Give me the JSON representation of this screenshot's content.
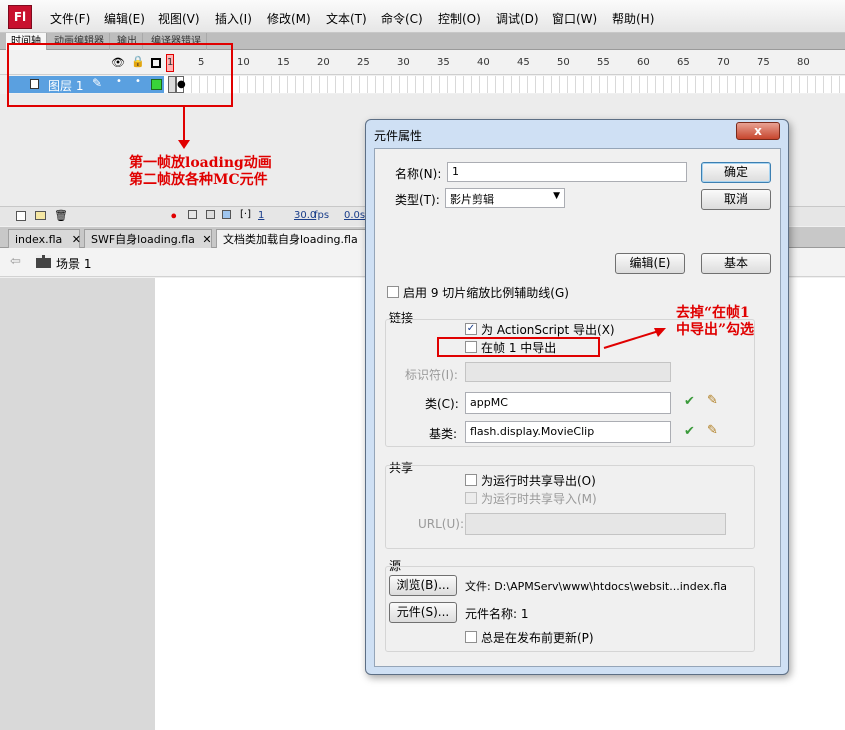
{
  "app": {
    "logo": "Fl"
  },
  "menu": [
    "文件(F)",
    "编辑(E)",
    "视图(V)",
    "插入(I)",
    "修改(M)",
    "文本(T)",
    "命令(C)",
    "控制(O)",
    "调试(D)",
    "窗口(W)",
    "帮助(H)"
  ],
  "panel_tabs": [
    "时间轴",
    "动画编辑器",
    "输出",
    "编译器错误"
  ],
  "timeline": {
    "frame_numbers": [
      "1",
      "5",
      "10",
      "15",
      "20",
      "25",
      "30",
      "35",
      "40",
      "45",
      "50",
      "55",
      "60",
      "65",
      "70",
      "75",
      "80"
    ],
    "layer_name": "图层 1",
    "footer": {
      "current_frame": "1",
      "fps": "30.0",
      "fps_unit": "fps",
      "time": "0.0s"
    }
  },
  "doc_tabs": [
    "index.fla",
    "SWF自身loading.fla",
    "文档类加载自身loading.fla"
  ],
  "scene": {
    "label": "场景 1"
  },
  "annotations": {
    "left_line1": "第一帧放loading动画",
    "left_line2": "第二帧放各种MC元件",
    "right_line1": "去掉“在帧1",
    "right_line2": "中导出”勾选"
  },
  "dialog": {
    "title": "元件属性",
    "close_label": "x",
    "name_label": "名称(N):",
    "name_value": "1",
    "type_label": "类型(T):",
    "type_value": "影片剪辑",
    "ok_label": "确定",
    "cancel_label": "取消",
    "edit_label": "编辑(E)",
    "basic_label": "基本",
    "slice9_label": "启用 9 切片缩放比例辅助线(G)",
    "linkage": {
      "title": "链接",
      "export_as3_label": "为 ActionScript 导出(X)",
      "export_as3_checked": true,
      "export_frame1_label": "在帧 1 中导出",
      "export_frame1_checked": false,
      "identifier_label": "标识符(I):",
      "class_label": "类(C):",
      "class_value": "appMC",
      "base_label": "基类:",
      "base_value": "flash.display.MovieClip"
    },
    "sharing": {
      "title": "共享",
      "export_runtime_label": "为运行时共享导出(O)",
      "import_runtime_label": "为运行时共享导入(M)",
      "url_label": "URL(U):"
    },
    "source": {
      "title": "源",
      "browse_label": "浏览(B)...",
      "file_text": "文件: D:\\APMServ\\www\\htdocs\\websit...index.fla",
      "symbol_label": "元件(S)...",
      "symbol_name_text": "元件名称:  1",
      "always_update_label": "总是在发布前更新(P)"
    }
  }
}
